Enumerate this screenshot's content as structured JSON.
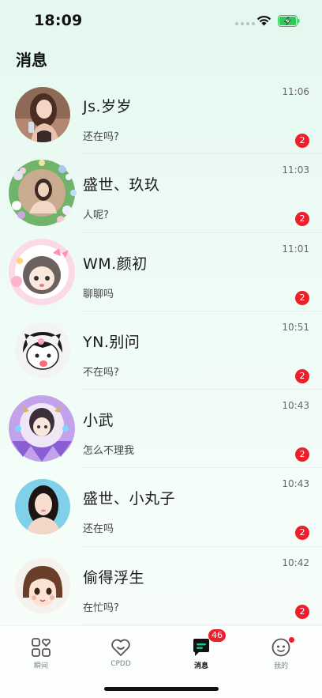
{
  "status_bar": {
    "time": "18:09"
  },
  "page": {
    "title": "消息"
  },
  "conversations": [
    {
      "name": "Js.岁岁",
      "preview": "还在吗?",
      "time": "11:06",
      "unread": "2",
      "avatar": "girl-photo-avatar"
    },
    {
      "name": "盛世、玖玖",
      "preview": "人呢?",
      "time": "11:03",
      "unread": "2",
      "avatar": "flower-frame-avatar"
    },
    {
      "name": "WM.颜初",
      "preview": "聊聊吗",
      "time": "11:01",
      "unread": "2",
      "avatar": "cartoon-pink-frame-avatar"
    },
    {
      "name": "YN.别问",
      "preview": "不在吗?",
      "time": "10:51",
      "unread": "2",
      "avatar": "kuromi-avatar"
    },
    {
      "name": "小武",
      "preview": "怎么不理我",
      "time": "10:43",
      "unread": "2",
      "avatar": "crystal-frame-avatar"
    },
    {
      "name": "盛世、小丸子",
      "preview": "还在吗",
      "time": "10:43",
      "unread": "2",
      "avatar": "girl-photo-avatar"
    },
    {
      "name": "偷得浮生",
      "preview": "在忙吗?",
      "time": "10:42",
      "unread": "2",
      "avatar": "cartoon-girl-avatar"
    }
  ],
  "tabs": [
    {
      "label": "瞬间",
      "icon": "moments-grid-icon"
    },
    {
      "label": "CPDD",
      "icon": "heart-icon"
    },
    {
      "label": "消息",
      "icon": "message-icon",
      "badge": "46",
      "active": true
    },
    {
      "label": "我的",
      "icon": "profile-face-icon"
    }
  ],
  "colors": {
    "accent": "#17c9a2",
    "badge": "#f01d2a"
  }
}
